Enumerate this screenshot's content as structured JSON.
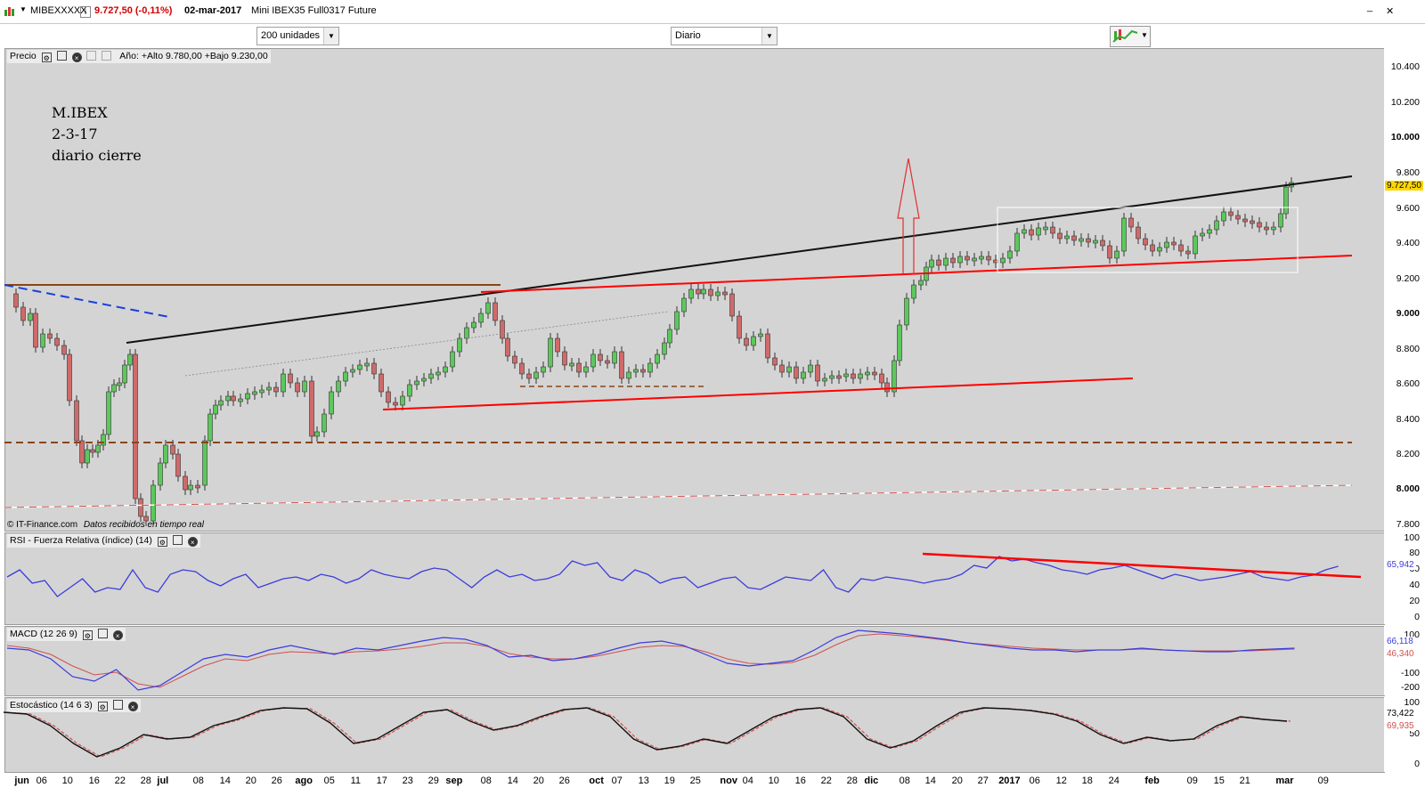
{
  "window": {
    "symbol": "MIBEXXXXX",
    "price_change": "9.727,50 (-0,11%)",
    "date": "02-mar-2017",
    "instrument": "Mini IBEX35 Full0317 Future",
    "minimize": "_",
    "close": "✕"
  },
  "toolbar": {
    "units_select": "200 unidades",
    "period_select": "Diario"
  },
  "price_panel": {
    "title": "Precio",
    "info": "Año: +Alto 9.780,00 +Bajo 9.230,00",
    "annotation": [
      "M.IBEX",
      "2-3-17",
      "diario cierre"
    ],
    "copyright": "© IT-Finance.com",
    "realtime": "Datos recibidos en tiempo real",
    "y_labels": [
      "10.400",
      "10.200",
      "10.000",
      "9.800",
      "9.600",
      "9.400",
      "9.200",
      "9.000",
      "8.800",
      "8.600",
      "8.400",
      "8.200",
      "8.000",
      "7.800"
    ],
    "last_price_tag": "9.727,50",
    "tag_color": "#ffd700"
  },
  "rsi_panel": {
    "title": "RSI - Fuerza Relativa (índice) (14)",
    "y_labels": [
      "100",
      "80",
      "60",
      "40",
      "20",
      "0"
    ],
    "value_tag": "65,942"
  },
  "macd_panel": {
    "title": "MACD (12 26 9)",
    "y_labels": [
      "100",
      "-100",
      "-200"
    ],
    "macd_tag": "66,118",
    "signal_tag": "46,340"
  },
  "stoch_panel": {
    "title": "Estocástico (14 6 3)",
    "y_labels": [
      "100",
      "50",
      "0"
    ],
    "k_tag": "73,422",
    "d_tag": "69,935"
  },
  "x_axis": {
    "labels": [
      "jun",
      "06",
      "10",
      "16",
      "22",
      "28",
      "jul",
      "08",
      "14",
      "20",
      "26",
      "ago",
      "05",
      "11",
      "17",
      "23",
      "29",
      "sep",
      "08",
      "14",
      "20",
      "26",
      "oct",
      "07",
      "13",
      "19",
      "25",
      "nov",
      "04",
      "10",
      "16",
      "22",
      "28",
      "dic",
      "08",
      "14",
      "20",
      "27",
      "2017",
      "06",
      "12",
      "18",
      "24",
      "feb",
      "09",
      "15",
      "21",
      "mar",
      "09"
    ],
    "month_labels": [
      "jun",
      "jul",
      "ago",
      "sep",
      "oct",
      "nov",
      "dic",
      "2017",
      "feb",
      "mar"
    ]
  },
  "colors": {
    "up_candle": "#5cc85c",
    "down_candle": "#d06a6a",
    "rsi_line": "#3c3cdc",
    "trend_red": "#ff0000",
    "support_brown": "#8b4513"
  }
}
